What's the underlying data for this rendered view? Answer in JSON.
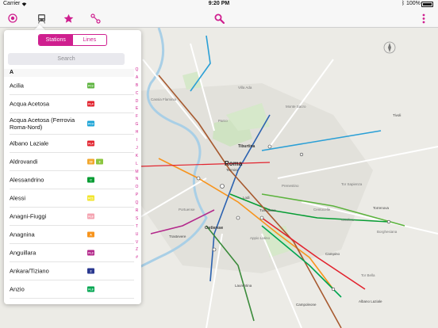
{
  "status_bar": {
    "carrier": "Carrier",
    "time": "9:20 PM",
    "battery": "100%"
  },
  "toolbar": {
    "icons": [
      "location-icon",
      "train-icon",
      "star-icon",
      "route-icon",
      "search-icon",
      "more-icon"
    ],
    "accent": "#cf1f8f"
  },
  "panel": {
    "segments": [
      "Stations",
      "Lines"
    ],
    "search_placeholder": "Search",
    "section": "A",
    "stations": [
      {
        "name": "Acilia",
        "badges": [
          {
            "text": "FC2",
            "color": "#5cb33d"
          }
        ]
      },
      {
        "name": "Acqua Acetosa",
        "badges": [
          {
            "text": "FL4",
            "color": "#e2232e"
          }
        ]
      },
      {
        "name": "Acqua Acetosa (Ferrovia Roma-Nord)",
        "badges": [
          {
            "text": "FC3",
            "color": "#19a3d6"
          }
        ]
      },
      {
        "name": "Albano Laziale",
        "badges": [
          {
            "text": "FL4",
            "color": "#e2232e"
          }
        ]
      },
      {
        "name": "Aldrovandi",
        "badges": [
          {
            "text": "19",
            "color": "#f2a72e"
          },
          {
            "text": "3",
            "color": "#8cc63f"
          }
        ]
      },
      {
        "name": "Alessandrino",
        "badges": [
          {
            "text": "C",
            "color": "#069c33"
          }
        ]
      },
      {
        "name": "Alessi",
        "badges": [
          {
            "text": "FC1",
            "color": "#f2e52d"
          }
        ]
      },
      {
        "name": "Anagni-Fiuggi",
        "badges": [
          {
            "text": "FL6",
            "color": "#f4a3b0"
          }
        ]
      },
      {
        "name": "Anagnina",
        "badges": [
          {
            "text": "A",
            "color": "#f7941d"
          }
        ]
      },
      {
        "name": "Anguillara",
        "badges": [
          {
            "text": "FL3",
            "color": "#b3288b"
          }
        ]
      },
      {
        "name": "Ankara/Tiziano",
        "badges": [
          {
            "text": "2",
            "color": "#2b3990"
          }
        ]
      },
      {
        "name": "Anzio",
        "badges": [
          {
            "text": "FL8",
            "color": "#00a651"
          }
        ]
      }
    ],
    "index_letters": [
      "Q",
      "A",
      "B",
      "C",
      "D",
      "E",
      "F",
      "G",
      "H",
      "I",
      "J",
      "K",
      "L",
      "M",
      "N",
      "O",
      "P",
      "Q",
      "R",
      "S",
      "T",
      "U",
      "V",
      "Z",
      "#"
    ]
  },
  "map": {
    "labels": [
      "Cassia Flaminia",
      "Monte Sacro",
      "Tiburtina",
      "Roma",
      "Termini",
      "Lodi",
      "Tuscolana",
      "Ostiense",
      "Trastevere",
      "Prenestino",
      "Centocelle",
      "Tor Sapienza",
      "Casilina",
      "Borghesiana",
      "Torrenova",
      "Campino",
      "Albano Laziale",
      "Laurentina",
      "Campoleone",
      "Portuense",
      "Appio Latino",
      "Tor Bella",
      "Tivoli",
      "Villa Ada",
      "Parco"
    ]
  }
}
